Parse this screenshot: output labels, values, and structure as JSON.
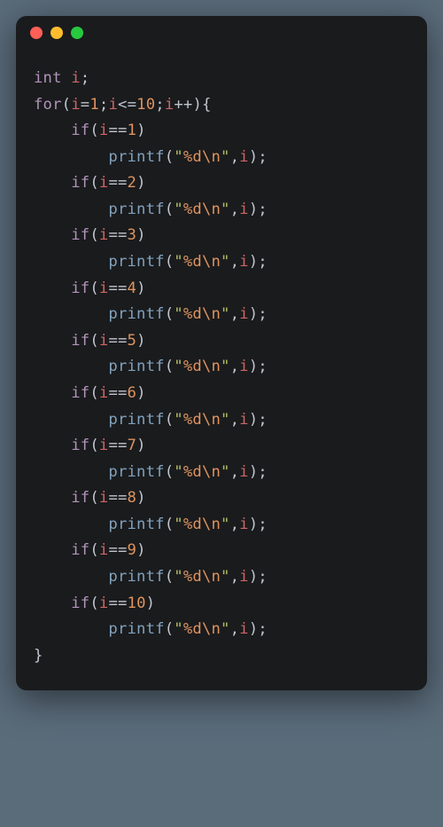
{
  "titlebar": {
    "dots": [
      "red",
      "yellow",
      "green"
    ]
  },
  "code": {
    "tokens": [
      {
        "type": "kw",
        "text": "int"
      },
      {
        "type": "op",
        "text": " "
      },
      {
        "type": "id",
        "text": "i"
      },
      {
        "type": "op",
        "text": ";"
      },
      {
        "type": "nl"
      },
      {
        "type": "kw",
        "text": "for"
      },
      {
        "type": "op",
        "text": "("
      },
      {
        "type": "id",
        "text": "i"
      },
      {
        "type": "op",
        "text": "="
      },
      {
        "type": "num",
        "text": "1"
      },
      {
        "type": "op",
        "text": ";"
      },
      {
        "type": "id",
        "text": "i"
      },
      {
        "type": "op",
        "text": "<="
      },
      {
        "type": "num",
        "text": "10"
      },
      {
        "type": "op",
        "text": ";"
      },
      {
        "type": "id",
        "text": "i"
      },
      {
        "type": "op",
        "text": "++){"
      },
      {
        "type": "nl"
      },
      {
        "type": "indent",
        "n": 1
      },
      {
        "type": "kw",
        "text": "if"
      },
      {
        "type": "op",
        "text": "("
      },
      {
        "type": "id",
        "text": "i"
      },
      {
        "type": "op",
        "text": "=="
      },
      {
        "type": "num",
        "text": "1"
      },
      {
        "type": "op",
        "text": ")"
      },
      {
        "type": "nl"
      },
      {
        "type": "indent",
        "n": 2
      },
      {
        "type": "fn",
        "text": "printf"
      },
      {
        "type": "op",
        "text": "("
      },
      {
        "type": "str",
        "text": "\""
      },
      {
        "type": "esc",
        "text": "%d"
      },
      {
        "type": "esc",
        "text": "\\n"
      },
      {
        "type": "str",
        "text": "\""
      },
      {
        "type": "op",
        "text": ","
      },
      {
        "type": "id",
        "text": "i"
      },
      {
        "type": "op",
        "text": ");"
      },
      {
        "type": "nl"
      },
      {
        "type": "indent",
        "n": 1
      },
      {
        "type": "kw",
        "text": "if"
      },
      {
        "type": "op",
        "text": "("
      },
      {
        "type": "id",
        "text": "i"
      },
      {
        "type": "op",
        "text": "=="
      },
      {
        "type": "num",
        "text": "2"
      },
      {
        "type": "op",
        "text": ")"
      },
      {
        "type": "nl"
      },
      {
        "type": "indent",
        "n": 2
      },
      {
        "type": "fn",
        "text": "printf"
      },
      {
        "type": "op",
        "text": "("
      },
      {
        "type": "str",
        "text": "\""
      },
      {
        "type": "esc",
        "text": "%d"
      },
      {
        "type": "esc",
        "text": "\\n"
      },
      {
        "type": "str",
        "text": "\""
      },
      {
        "type": "op",
        "text": ","
      },
      {
        "type": "id",
        "text": "i"
      },
      {
        "type": "op",
        "text": ");"
      },
      {
        "type": "nl"
      },
      {
        "type": "indent",
        "n": 1
      },
      {
        "type": "kw",
        "text": "if"
      },
      {
        "type": "op",
        "text": "("
      },
      {
        "type": "id",
        "text": "i"
      },
      {
        "type": "op",
        "text": "=="
      },
      {
        "type": "num",
        "text": "3"
      },
      {
        "type": "op",
        "text": ")"
      },
      {
        "type": "nl"
      },
      {
        "type": "indent",
        "n": 2
      },
      {
        "type": "fn",
        "text": "printf"
      },
      {
        "type": "op",
        "text": "("
      },
      {
        "type": "str",
        "text": "\""
      },
      {
        "type": "esc",
        "text": "%d"
      },
      {
        "type": "esc",
        "text": "\\n"
      },
      {
        "type": "str",
        "text": "\""
      },
      {
        "type": "op",
        "text": ","
      },
      {
        "type": "id",
        "text": "i"
      },
      {
        "type": "op",
        "text": ");"
      },
      {
        "type": "nl"
      },
      {
        "type": "indent",
        "n": 1
      },
      {
        "type": "kw",
        "text": "if"
      },
      {
        "type": "op",
        "text": "("
      },
      {
        "type": "id",
        "text": "i"
      },
      {
        "type": "op",
        "text": "=="
      },
      {
        "type": "num",
        "text": "4"
      },
      {
        "type": "op",
        "text": ")"
      },
      {
        "type": "nl"
      },
      {
        "type": "indent",
        "n": 2
      },
      {
        "type": "fn",
        "text": "printf"
      },
      {
        "type": "op",
        "text": "("
      },
      {
        "type": "str",
        "text": "\""
      },
      {
        "type": "esc",
        "text": "%d"
      },
      {
        "type": "esc",
        "text": "\\n"
      },
      {
        "type": "str",
        "text": "\""
      },
      {
        "type": "op",
        "text": ","
      },
      {
        "type": "id",
        "text": "i"
      },
      {
        "type": "op",
        "text": ");"
      },
      {
        "type": "nl"
      },
      {
        "type": "indent",
        "n": 1
      },
      {
        "type": "kw",
        "text": "if"
      },
      {
        "type": "op",
        "text": "("
      },
      {
        "type": "id",
        "text": "i"
      },
      {
        "type": "op",
        "text": "=="
      },
      {
        "type": "num",
        "text": "5"
      },
      {
        "type": "op",
        "text": ")"
      },
      {
        "type": "nl"
      },
      {
        "type": "indent",
        "n": 2
      },
      {
        "type": "fn",
        "text": "printf"
      },
      {
        "type": "op",
        "text": "("
      },
      {
        "type": "str",
        "text": "\""
      },
      {
        "type": "esc",
        "text": "%d"
      },
      {
        "type": "esc",
        "text": "\\n"
      },
      {
        "type": "str",
        "text": "\""
      },
      {
        "type": "op",
        "text": ","
      },
      {
        "type": "id",
        "text": "i"
      },
      {
        "type": "op",
        "text": ");"
      },
      {
        "type": "nl"
      },
      {
        "type": "indent",
        "n": 1
      },
      {
        "type": "kw",
        "text": "if"
      },
      {
        "type": "op",
        "text": "("
      },
      {
        "type": "id",
        "text": "i"
      },
      {
        "type": "op",
        "text": "=="
      },
      {
        "type": "num",
        "text": "6"
      },
      {
        "type": "op",
        "text": ")"
      },
      {
        "type": "nl"
      },
      {
        "type": "indent",
        "n": 2
      },
      {
        "type": "fn",
        "text": "printf"
      },
      {
        "type": "op",
        "text": "("
      },
      {
        "type": "str",
        "text": "\""
      },
      {
        "type": "esc",
        "text": "%d"
      },
      {
        "type": "esc",
        "text": "\\n"
      },
      {
        "type": "str",
        "text": "\""
      },
      {
        "type": "op",
        "text": ","
      },
      {
        "type": "id",
        "text": "i"
      },
      {
        "type": "op",
        "text": ");"
      },
      {
        "type": "nl"
      },
      {
        "type": "indent",
        "n": 1
      },
      {
        "type": "kw",
        "text": "if"
      },
      {
        "type": "op",
        "text": "("
      },
      {
        "type": "id",
        "text": "i"
      },
      {
        "type": "op",
        "text": "=="
      },
      {
        "type": "num",
        "text": "7"
      },
      {
        "type": "op",
        "text": ")"
      },
      {
        "type": "nl"
      },
      {
        "type": "indent",
        "n": 2
      },
      {
        "type": "fn",
        "text": "printf"
      },
      {
        "type": "op",
        "text": "("
      },
      {
        "type": "str",
        "text": "\""
      },
      {
        "type": "esc",
        "text": "%d"
      },
      {
        "type": "esc",
        "text": "\\n"
      },
      {
        "type": "str",
        "text": "\""
      },
      {
        "type": "op",
        "text": ","
      },
      {
        "type": "id",
        "text": "i"
      },
      {
        "type": "op",
        "text": ");"
      },
      {
        "type": "nl"
      },
      {
        "type": "indent",
        "n": 1
      },
      {
        "type": "kw",
        "text": "if"
      },
      {
        "type": "op",
        "text": "("
      },
      {
        "type": "id",
        "text": "i"
      },
      {
        "type": "op",
        "text": "=="
      },
      {
        "type": "num",
        "text": "8"
      },
      {
        "type": "op",
        "text": ")"
      },
      {
        "type": "nl"
      },
      {
        "type": "indent",
        "n": 2
      },
      {
        "type": "fn",
        "text": "printf"
      },
      {
        "type": "op",
        "text": "("
      },
      {
        "type": "str",
        "text": "\""
      },
      {
        "type": "esc",
        "text": "%d"
      },
      {
        "type": "esc",
        "text": "\\n"
      },
      {
        "type": "str",
        "text": "\""
      },
      {
        "type": "op",
        "text": ","
      },
      {
        "type": "id",
        "text": "i"
      },
      {
        "type": "op",
        "text": ");"
      },
      {
        "type": "nl"
      },
      {
        "type": "indent",
        "n": 1
      },
      {
        "type": "kw",
        "text": "if"
      },
      {
        "type": "op",
        "text": "("
      },
      {
        "type": "id",
        "text": "i"
      },
      {
        "type": "op",
        "text": "=="
      },
      {
        "type": "num",
        "text": "9"
      },
      {
        "type": "op",
        "text": ")"
      },
      {
        "type": "nl"
      },
      {
        "type": "indent",
        "n": 2
      },
      {
        "type": "fn",
        "text": "printf"
      },
      {
        "type": "op",
        "text": "("
      },
      {
        "type": "str",
        "text": "\""
      },
      {
        "type": "esc",
        "text": "%d"
      },
      {
        "type": "esc",
        "text": "\\n"
      },
      {
        "type": "str",
        "text": "\""
      },
      {
        "type": "op",
        "text": ","
      },
      {
        "type": "id",
        "text": "i"
      },
      {
        "type": "op",
        "text": ");"
      },
      {
        "type": "nl"
      },
      {
        "type": "indent",
        "n": 1
      },
      {
        "type": "kw",
        "text": "if"
      },
      {
        "type": "op",
        "text": "("
      },
      {
        "type": "id",
        "text": "i"
      },
      {
        "type": "op",
        "text": "=="
      },
      {
        "type": "num",
        "text": "10"
      },
      {
        "type": "op",
        "text": ")"
      },
      {
        "type": "nl"
      },
      {
        "type": "indent",
        "n": 2
      },
      {
        "type": "fn",
        "text": "printf"
      },
      {
        "type": "op",
        "text": "("
      },
      {
        "type": "str",
        "text": "\""
      },
      {
        "type": "esc",
        "text": "%d"
      },
      {
        "type": "esc",
        "text": "\\n"
      },
      {
        "type": "str",
        "text": "\""
      },
      {
        "type": "op",
        "text": ","
      },
      {
        "type": "id",
        "text": "i"
      },
      {
        "type": "op",
        "text": ");"
      },
      {
        "type": "nl"
      },
      {
        "type": "op",
        "text": "}"
      }
    ],
    "indent_unit": "    "
  }
}
